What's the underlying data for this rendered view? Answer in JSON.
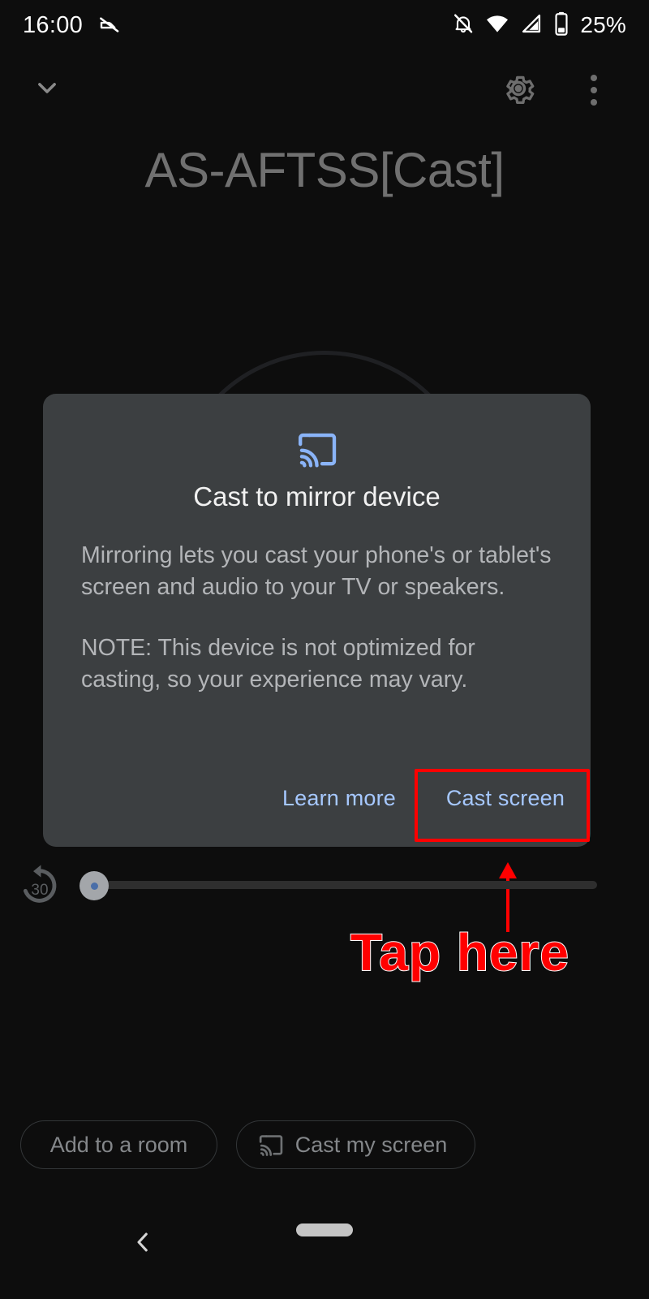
{
  "status_bar": {
    "time": "16:00",
    "battery_percent": "25%",
    "icons": {
      "left_mute": "notifications-muted-icon",
      "bell_off": "bell-off-icon",
      "wifi": "wifi-icon",
      "cellular": "cellular-signal-icon",
      "battery": "battery-icon"
    }
  },
  "top_bar": {
    "collapse_icon": "chevron-down-icon",
    "settings_icon": "gear-icon",
    "overflow_icon": "more-vert-icon"
  },
  "device": {
    "title": "AS-AFTSS[Cast]"
  },
  "dialog": {
    "icon": "cast-icon",
    "title": "Cast to mirror device",
    "body_paragraph_1": "Mirroring lets you cast your phone's or tablet's screen and audio to your TV or speakers.",
    "body_paragraph_2": "NOTE: This device is not optimized for casting, so your experience may vary.",
    "learn_more_label": "Learn more",
    "cast_screen_label": "Cast screen"
  },
  "annotation": {
    "label": "Tap here",
    "color": "#ff0000",
    "outline_color": "#ffffff",
    "arrow": "up-arrow-icon",
    "highlight_target": "Cast screen"
  },
  "transport": {
    "replay_icon": "replay-30-icon",
    "replay_seconds": "30",
    "slider_value_percent": 0
  },
  "chips": [
    {
      "label": "Add to a room",
      "icon": null
    },
    {
      "label": "Cast my screen",
      "icon": "cast-icon"
    }
  ],
  "nav_bar": {
    "back_icon": "chevron-left-icon",
    "home_indicator": "home-pill-indicator"
  },
  "colors": {
    "background": "#0d0d0d",
    "dialog_background": "#3c3f41",
    "accent_blue": "#a6c8ff",
    "cast_icon_blue": "#8ab4f8",
    "title_gray": "#707070",
    "body_gray": "#b3b5b8",
    "annotation_red": "#ff0000"
  }
}
